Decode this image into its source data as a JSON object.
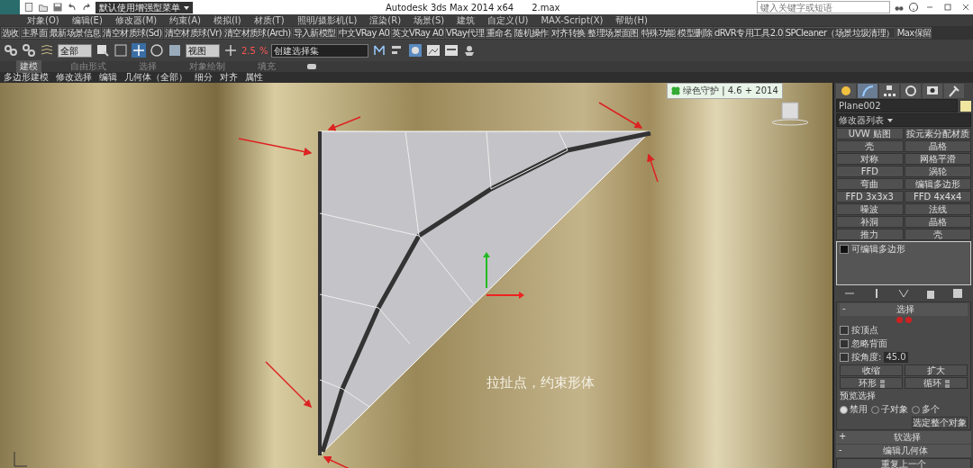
{
  "title_bar": {
    "quick_menu": "默认使用增强型菜单",
    "title": "Autodesk 3ds Max  2014 x64",
    "file": "2.max",
    "search": {
      "placeholder": "键入关键字或短语"
    }
  },
  "menu_bar": [
    "对象(O)",
    "编辑(E)",
    "修改器(M)",
    "约束(A)",
    "模拟(I)",
    "材质(T)",
    "照明/摄影机(L)",
    "渲染(R)",
    "场景(S)",
    "建筑",
    "自定义(U)",
    "MAX-Script(X)",
    "帮助(H)"
  ],
  "plugin_toolbar": [
    "选收",
    "主界面",
    "最新场景信息",
    "清空材质球(Sd)",
    "清空材质球(Vr)",
    "清空材质球(Arch)",
    "导入新模型",
    "中文VRay A0",
    "英文VRay A0",
    "VRay代理",
    "重命名",
    "随机操作",
    "对齐转换",
    "整理场景面图",
    "特殊功能",
    "模型删除",
    "dRVR专用工具2.0",
    "SPCleaner（场景垃圾清理）",
    "Max保留"
  ],
  "main_toolbar": {
    "selection_filter": "全部",
    "coordinate_system": "视图",
    "angle_snap": "2.5",
    "percent_snap": "%",
    "selection_set": "创建选择集"
  },
  "ribbon": {
    "tabs": [
      {
        "label": "建模",
        "selected": true
      },
      {
        "label": "自由形式",
        "selected": false
      },
      {
        "label": "选择",
        "selected": false
      },
      {
        "label": "对象绘制",
        "selected": false
      },
      {
        "label": "填充",
        "selected": false
      }
    ],
    "groups": [
      "多边形建模",
      "修改选择",
      "编辑",
      "几何体（全部）",
      "细分",
      "对齐",
      "属性"
    ]
  },
  "viewport": {
    "badge": "绿色守护 | 4.6 + 2014",
    "caption": "拉扯点，约束形体"
  },
  "command_panel": {
    "tabs": [
      {
        "kind": "create",
        "selected": false
      },
      {
        "kind": "modify",
        "selected": true
      },
      {
        "kind": "hierarchy",
        "selected": false
      },
      {
        "kind": "motion",
        "selected": false
      },
      {
        "kind": "display",
        "selected": false
      },
      {
        "kind": "utilities",
        "selected": false
      }
    ],
    "object_name": "Plane002",
    "modifier_list": "修改器列表",
    "modifier_buttons": [
      "UVW 贴图",
      "按元素分配材质",
      "壳",
      "晶格",
      "对称",
      "网格平滑",
      "FFD",
      "涡轮",
      "弯曲",
      "编辑多边形",
      "FFD 3x3x3",
      "FFD 4x4x4",
      "噪波",
      "法线",
      "补洞",
      "晶格",
      "推力",
      "壳"
    ],
    "stack": [
      {
        "label": "可编辑多边形",
        "selected": false
      }
    ],
    "selection_rollout": {
      "sign": "-",
      "title": "选择",
      "options": [
        {
          "label": "按顶点",
          "checked": false
        },
        {
          "label": "忽略背面",
          "checked": false
        },
        {
          "label": "按角度:",
          "checked": false
        }
      ],
      "angle": "45.0",
      "buttons": [
        "收缩",
        "扩大"
      ],
      "spinners": [
        "环形",
        "循环"
      ],
      "preview": {
        "label": "预览选择",
        "options": [
          {
            "label": "禁用",
            "selected": true
          },
          {
            "label": "子对象",
            "selected": false
          },
          {
            "label": "多个",
            "selected": false
          }
        ]
      },
      "select_whole": "选定整个对象"
    },
    "rollouts": [
      {
        "sign": "+",
        "title": "软选择"
      },
      {
        "sign": "-",
        "title": "编辑几何体"
      }
    ],
    "last_button": "重复上一个"
  }
}
